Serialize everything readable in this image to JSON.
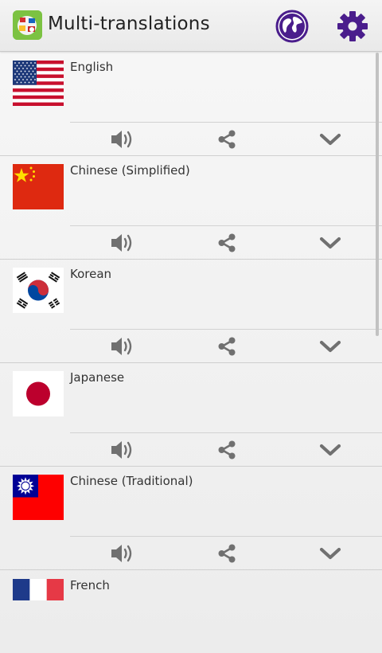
{
  "app": {
    "title": "Multi-translations"
  },
  "colors": {
    "accent_purple": "#4a1d8c",
    "icon_gray": "#707070"
  },
  "icons": {
    "app_logo": "app-logo-icon",
    "globe": "globe-icon",
    "settings": "gear-icon",
    "speak": "speaker-icon",
    "share": "share-icon",
    "more": "chevron-down-icon"
  },
  "languages": [
    {
      "name": "English",
      "flag": "us-flag"
    },
    {
      "name": "Chinese (Simplified)",
      "flag": "china-flag"
    },
    {
      "name": "Korean",
      "flag": "korea-flag"
    },
    {
      "name": "Japanese",
      "flag": "japan-flag"
    },
    {
      "name": "Chinese (Traditional)",
      "flag": "taiwan-flag"
    },
    {
      "name": "French",
      "flag": "france-flag"
    }
  ]
}
